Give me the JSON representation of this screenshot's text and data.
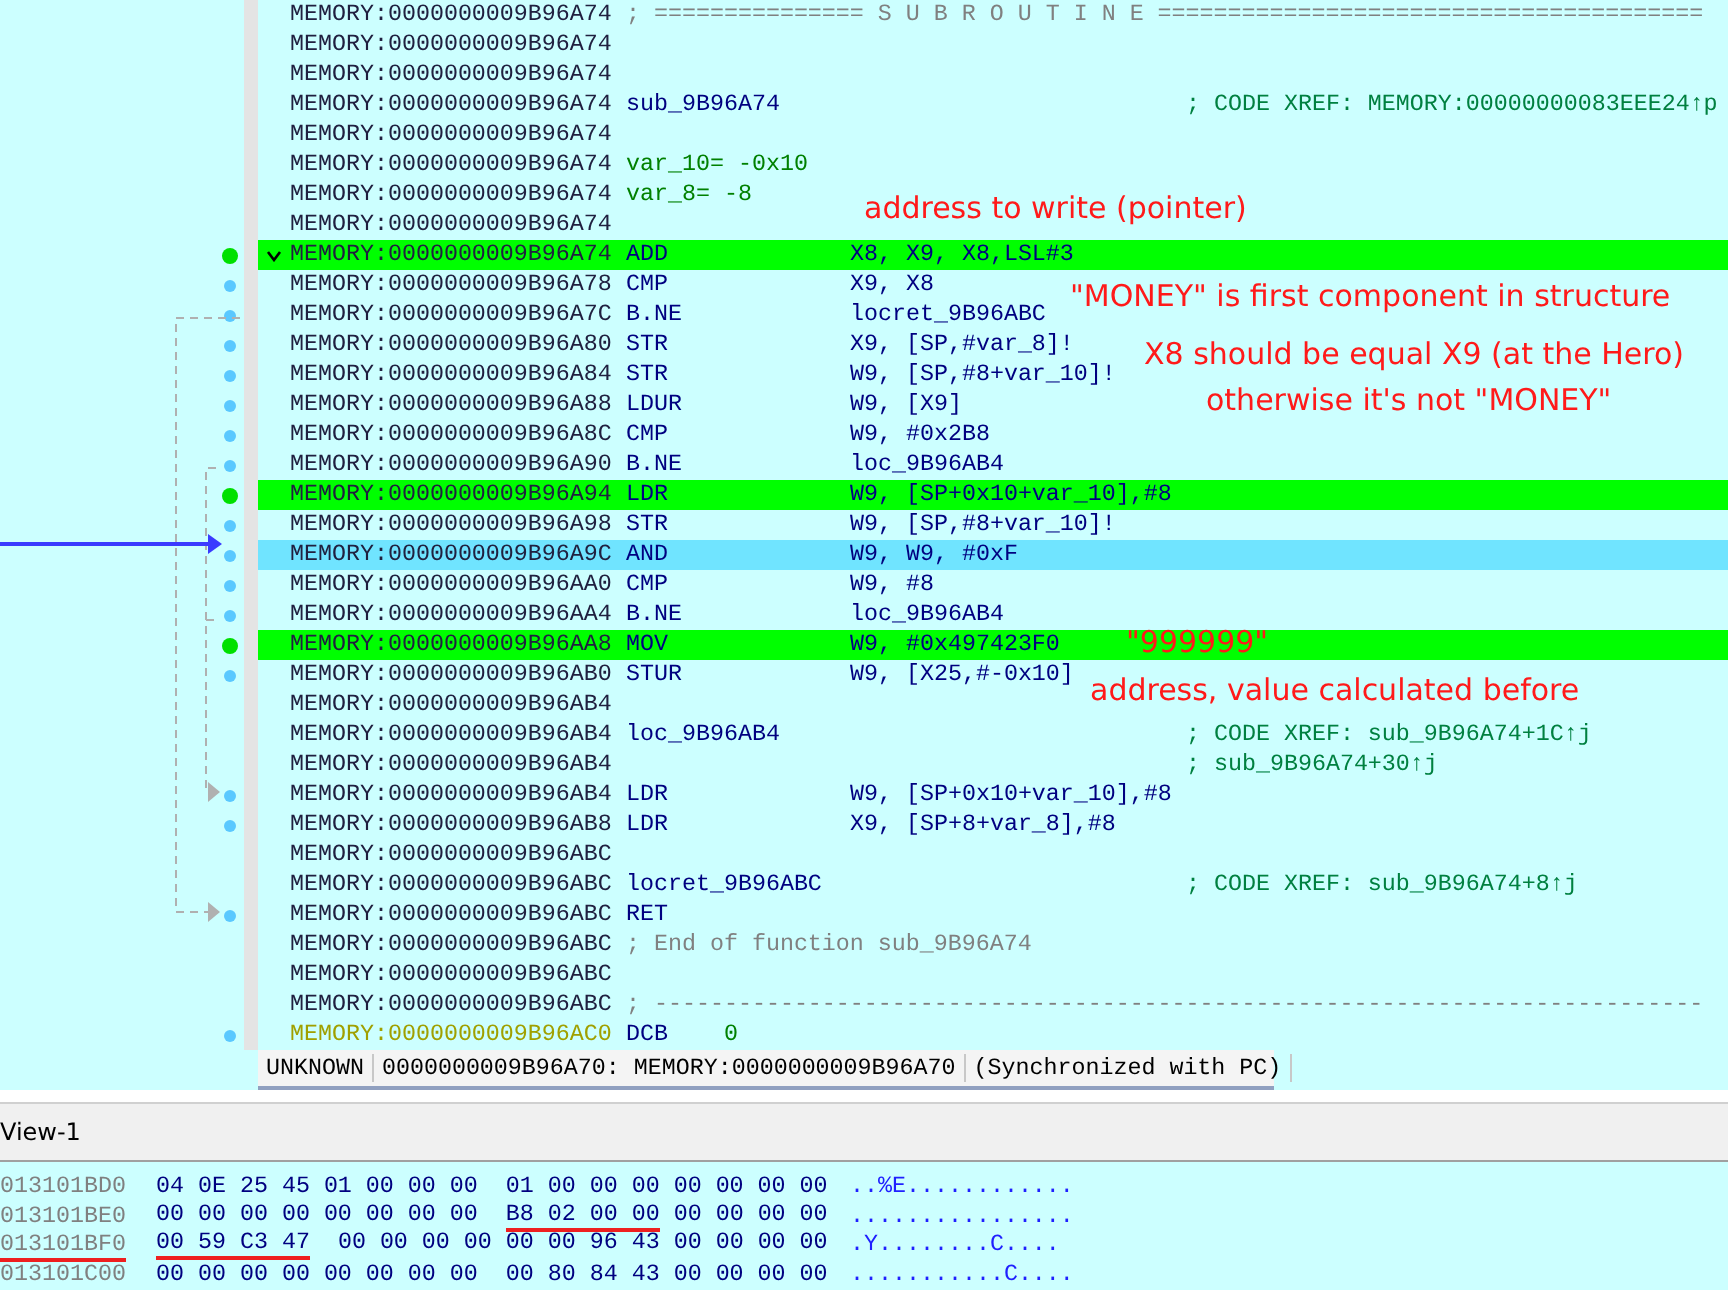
{
  "listing": {
    "rows": [
      {
        "address": "MEMORY:0000000009B96A74",
        "note": "; =============== S U B R O U T I N E =======================================",
        "highlighted": false,
        "selected": false
      },
      {
        "address": "MEMORY:0000000009B96A74",
        "highlighted": false,
        "selected": false
      },
      {
        "address": "MEMORY:0000000009B96A74",
        "highlighted": false,
        "selected": false
      },
      {
        "address": "MEMORY:0000000009B96A74",
        "label": "sub_9B96A74",
        "comment": "; CODE XREF: MEMORY:00000000083EEE24↑p",
        "highlighted": false,
        "selected": false
      },
      {
        "address": "MEMORY:0000000009B96A74",
        "highlighted": false,
        "selected": false
      },
      {
        "address": "MEMORY:0000000009B96A74",
        "var": "var_10= -0x10",
        "highlighted": false,
        "selected": false
      },
      {
        "address": "MEMORY:0000000009B96A74",
        "var": "var_8= -8",
        "highlighted": false,
        "selected": false
      },
      {
        "address": "MEMORY:0000000009B96A74",
        "highlighted": false,
        "selected": false
      },
      {
        "address": "MEMORY:0000000009B96A74",
        "mnemonic": "ADD",
        "operands": "X8, X9, X8,LSL#3",
        "highlighted": true,
        "selected": false,
        "color": "#00e000",
        "expanded": true
      },
      {
        "address": "MEMORY:0000000009B96A78",
        "mnemonic": "CMP",
        "operands": "X9, X8",
        "highlighted": false,
        "selected": false,
        "color": "#5ac8ff"
      },
      {
        "address": "MEMORY:0000000009B96A7C",
        "mnemonic": "B.NE",
        "operands": "locret_9B96ABC",
        "highlighted": false,
        "selected": false,
        "color": "#5ac8ff"
      },
      {
        "address": "MEMORY:0000000009B96A80",
        "mnemonic": "STR",
        "operands": "X9, [SP,#var_8]!",
        "highlighted": false,
        "selected": false,
        "color": "#5ac8ff"
      },
      {
        "address": "MEMORY:0000000009B96A84",
        "mnemonic": "STR",
        "operands": "W9, [SP,#8+var_10]!",
        "highlighted": false,
        "selected": false,
        "color": "#5ac8ff"
      },
      {
        "address": "MEMORY:0000000009B96A88",
        "mnemonic": "LDUR",
        "operands": "W9, [X9]",
        "highlighted": false,
        "selected": false,
        "color": "#5ac8ff"
      },
      {
        "address": "MEMORY:0000000009B96A8C",
        "mnemonic": "CMP",
        "operands": "W9, #0x2B8",
        "highlighted": false,
        "selected": false,
        "color": "#5ac8ff"
      },
      {
        "address": "MEMORY:0000000009B96A90",
        "mnemonic": "B.NE",
        "operands": "loc_9B96AB4",
        "highlighted": false,
        "selected": false,
        "color": "#5ac8ff"
      },
      {
        "address": "MEMORY:0000000009B96A94",
        "mnemonic": "LDR",
        "operands": "W9, [SP+0x10+var_10],#8",
        "highlighted": true,
        "selected": false,
        "color": "#00e000"
      },
      {
        "address": "MEMORY:0000000009B96A98",
        "mnemonic": "STR",
        "operands": "W9, [SP,#8+var_10]!",
        "highlighted": false,
        "selected": false,
        "color": "#5ac8ff"
      },
      {
        "address": "MEMORY:0000000009B96A9C",
        "mnemonic": "AND",
        "operands": "W9, W9, #0xF",
        "highlighted": false,
        "selected": true,
        "color": "#5ac8ff"
      },
      {
        "address": "MEMORY:0000000009B96AA0",
        "mnemonic": "CMP",
        "operands": "W9, #8",
        "highlighted": false,
        "selected": false,
        "color": "#5ac8ff"
      },
      {
        "address": "MEMORY:0000000009B96AA4",
        "mnemonic": "B.NE",
        "operands": "loc_9B96AB4",
        "highlighted": false,
        "selected": false,
        "color": "#5ac8ff"
      },
      {
        "address": "MEMORY:0000000009B96AA8",
        "mnemonic": "MOV",
        "operands": "W9, #0x497423F0",
        "highlighted": true,
        "selected": false,
        "color": "#00e000"
      },
      {
        "address": "MEMORY:0000000009B96AB0",
        "mnemonic": "STUR",
        "operands": "W9, [X25,#-0x10]",
        "highlighted": false,
        "selected": false,
        "color": "#5ac8ff"
      },
      {
        "address": "MEMORY:0000000009B96AB4",
        "highlighted": false,
        "selected": false
      },
      {
        "address": "MEMORY:0000000009B96AB4",
        "label": "loc_9B96AB4",
        "comment": "; CODE XREF: sub_9B96A74+1C↑j",
        "highlighted": false,
        "selected": false
      },
      {
        "address": "MEMORY:0000000009B96AB4",
        "comment": "; sub_9B96A74+30↑j",
        "highlighted": false,
        "selected": false
      },
      {
        "address": "MEMORY:0000000009B96AB4",
        "mnemonic": "LDR",
        "operands": "W9, [SP+0x10+var_10],#8",
        "highlighted": false,
        "selected": false,
        "color": "#5ac8ff"
      },
      {
        "address": "MEMORY:0000000009B96AB8",
        "mnemonic": "LDR",
        "operands": "X9, [SP+8+var_8],#8",
        "highlighted": false,
        "selected": false,
        "color": "#5ac8ff"
      },
      {
        "address": "MEMORY:0000000009B96ABC",
        "highlighted": false,
        "selected": false
      },
      {
        "address": "MEMORY:0000000009B96ABC",
        "label": "locret_9B96ABC",
        "comment": "; CODE XREF: sub_9B96A74+8↑j",
        "highlighted": false,
        "selected": false
      },
      {
        "address": "MEMORY:0000000009B96ABC",
        "mnemonic": "RET",
        "highlighted": false,
        "selected": false,
        "color": "#5ac8ff"
      },
      {
        "address": "MEMORY:0000000009B96ABC",
        "note": "; End of function sub_9B96A74",
        "highlighted": false,
        "selected": false
      },
      {
        "address": "MEMORY:0000000009B96ABC",
        "highlighted": false,
        "selected": false
      },
      {
        "address": "MEMORY:0000000009B96ABC",
        "note": "; ---------------------------------------------------------------------------",
        "highlighted": false,
        "selected": false
      },
      {
        "address": "MEMORY:0000000009B96AC0",
        "kind": "data",
        "mnemonic": "DCB",
        "value": "0",
        "highlighted": false,
        "selected": false,
        "color": "#5ac8ff"
      }
    ]
  },
  "annotations": [
    {
      "text": "address to write (pointer)"
    },
    {
      "text": "\"MONEY\" is first component in structure"
    },
    {
      "text": "X8 should be equal X9 (at the Hero)"
    },
    {
      "text": "otherwise it's not \"MONEY\""
    },
    {
      "text": "\"999999\""
    },
    {
      "text": "address, value calculated before"
    }
  ],
  "status_bar": [
    "UNKNOWN",
    "0000000009B96A70: MEMORY:0000000009B96A70",
    "(Synchronized with PC)"
  ],
  "hex_view": {
    "title": "View-1",
    "rows": [
      {
        "address": "013101BD0",
        "address_underlined": false,
        "groups": [
          {
            "text": "04 0E 25 45 01 00 00 00",
            "underlined": false
          },
          {
            "text": "01 00 00 00 00 00 00 00",
            "underlined": false
          }
        ],
        "ascii": "..%E............"
      },
      {
        "address": "013101BE0",
        "address_underlined": false,
        "groups": [
          {
            "text": "00 00 00 00 00 00 00 00",
            "underlined": false
          },
          {
            "text": "B8 02 00 00",
            "underlined": true
          },
          {
            "text": "00 00 00 00",
            "underlined": false
          }
        ],
        "ascii": "................"
      },
      {
        "address": "013101BF0",
        "address_underlined": true,
        "groups": [
          {
            "text": "00 59 C3 47",
            "underlined": true
          },
          {
            "text": "00 00 00 00",
            "underlined": false
          },
          {
            "text": "00 00 96 43 00 00 00 00",
            "underlined": false
          }
        ],
        "ascii": ".Y........C...."
      },
      {
        "address": "013101C00",
        "address_underlined": false,
        "groups": [
          {
            "text": "00 00 00 00 00 00 00 00",
            "underlined": false
          },
          {
            "text": "00 80 84 43 00 00 00 00",
            "underlined": false
          }
        ],
        "ascii": "...........C...."
      }
    ]
  }
}
